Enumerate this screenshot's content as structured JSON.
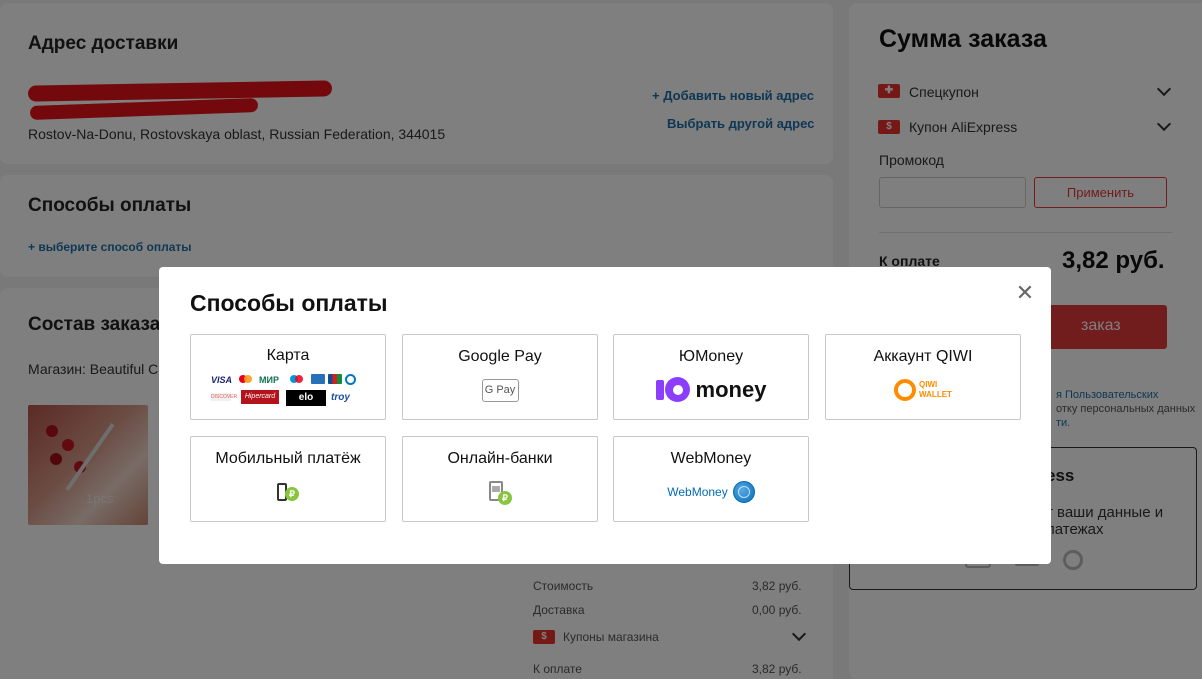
{
  "address": {
    "title": "Адрес доставки",
    "line_city": "Rostov-Na-Donu, Rostovskaya oblast, Russian Federation, 344015",
    "add_new": "+ Добавить новый адрес",
    "choose_other": "Выбрать другой адрес"
  },
  "payment_section": {
    "title": "Способы оплаты",
    "choose_link": "+ выберите способ оплаты"
  },
  "order_section": {
    "title": "Состав заказа",
    "store_prefix": "Магазин: Beautiful C",
    "product_caption": "1pcs"
  },
  "bottom_summary": {
    "cost_label": "Стоимость",
    "cost_value": "3,82 руб.",
    "delivery_label": "Доставка",
    "delivery_value": "0,00 руб.",
    "coupons_label": "Купоны магазина",
    "total_label": "К оплате",
    "total_value": "3,82 руб."
  },
  "summary": {
    "title": "Сумма заказа",
    "special_coupon": "Спецкупон",
    "ali_coupon": "Купон AliExpress",
    "promo_label": "Промокод",
    "promo_placeholder": "",
    "apply_button": "Применить",
    "total_label": "К оплате",
    "total_value": "3,82 руб.",
    "order_button": "заказ",
    "legal_part1": "я Пользовательских",
    "legal_part2": "отку персональных данных",
    "legal_part3": "ти.",
    "promo_box_title": "ess",
    "promo_box_text1": "т ваши данные и",
    "promo_box_text2": "латежах"
  },
  "modal": {
    "title": "Способы оплаты",
    "close_icon": "close-icon",
    "options": [
      {
        "label": "Карта",
        "icon": "card-brands-icon"
      },
      {
        "label": "Google Pay",
        "icon": "google-pay-icon",
        "logo_text": "G Pay"
      },
      {
        "label": "ЮMoney",
        "icon": "yoomoney-icon",
        "logo_text": "money"
      },
      {
        "label": "Аккаунт QIWI",
        "icon": "qiwi-icon",
        "logo_text1": "QIWI",
        "logo_text2": "WALLET"
      },
      {
        "label": "Мобильный платёж",
        "icon": "mobile-payment-icon"
      },
      {
        "label": "Онлайн-банки",
        "icon": "online-bank-icon"
      },
      {
        "label": "WebMoney",
        "icon": "webmoney-icon",
        "logo_text": "WebMoney"
      }
    ],
    "card_brands": [
      "VISA",
      "МИР",
      "Hipercard",
      "elo",
      "troy"
    ]
  },
  "colors": {
    "accent_red": "#e23a3a",
    "link_blue": "#1f6fa8",
    "yoomoney_purple": "#8b3ffd",
    "qiwi_orange": "#ff8c00",
    "webmoney_blue": "#036cb5"
  }
}
